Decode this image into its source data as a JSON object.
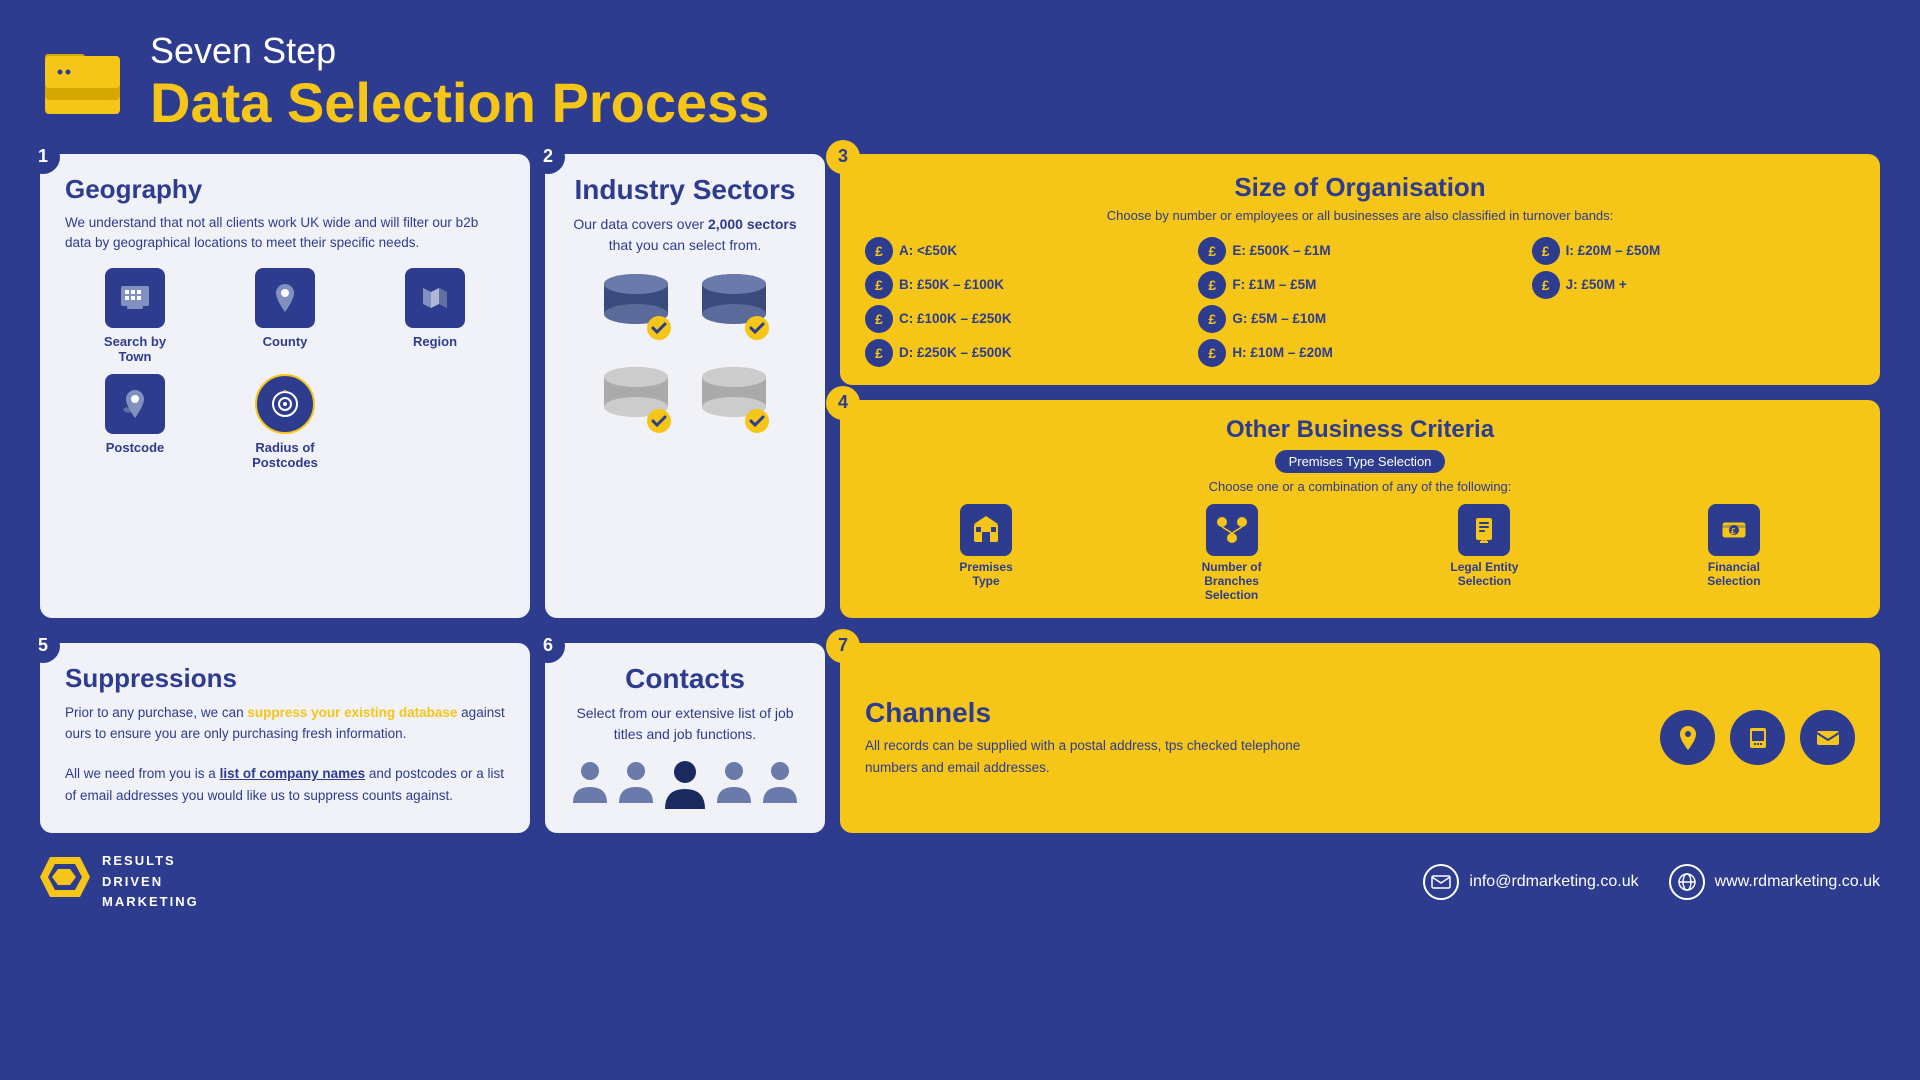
{
  "header": {
    "subtitle": "Seven Step",
    "title": "Data Selection Process"
  },
  "step1": {
    "num": "1",
    "title": "Geography",
    "body": "We understand that not all clients work UK wide and will filter our b2b data by geographical locations to meet their specific needs.",
    "icons": [
      {
        "label": "Search by Town",
        "icon": "🏢"
      },
      {
        "label": "County",
        "icon": "📍"
      },
      {
        "label": "Region",
        "icon": "🗺"
      },
      {
        "label": "Postcode",
        "icon": "📌"
      },
      {
        "label": "Radius of Postcodes",
        "icon": "⊙"
      }
    ]
  },
  "step2": {
    "num": "2",
    "title": "Industry Sectors",
    "body": "Our data covers over 2,000 sectors that you can select from."
  },
  "step3": {
    "num": "3",
    "title": "Size of Organisation",
    "subtitle": "Choose by number or employees or all businesses are also classified in turnover bands:",
    "items": [
      {
        "label": "A: <£50K"
      },
      {
        "label": "E: £500K – £1M"
      },
      {
        "label": "I: £20M – £50M"
      },
      {
        "label": "B: £50K – £100K"
      },
      {
        "label": "F: £1M – £5M"
      },
      {
        "label": "J: £50M +"
      },
      {
        "label": "C: £100K – £250K"
      },
      {
        "label": "G: £5M – £10M"
      },
      {
        "label": ""
      },
      {
        "label": "D: £250K – £500K"
      },
      {
        "label": "H: £10M – £20M"
      },
      {
        "label": ""
      }
    ]
  },
  "step4": {
    "num": "4",
    "title": "Other Business Criteria",
    "badge": "Premises Type Selection",
    "subtitle": "Choose one or a combination of any of the following:",
    "icons": [
      {
        "label": "Premises Type",
        "icon": "🏢"
      },
      {
        "label": "Number of Branches Selection",
        "icon": "📍"
      },
      {
        "label": "Legal Entity Selection",
        "icon": "⚖"
      },
      {
        "label": "Financial Selection",
        "icon": "💷"
      }
    ]
  },
  "step5": {
    "num": "5",
    "title": "Suppressions",
    "body1": "Prior to any purchase, we can",
    "highlight1": "suppress your existing database",
    "body1b": "against ours to ensure you are only purchasing fresh information.",
    "body2_pre": "All we need from you is a",
    "link_text": "list of company names",
    "body2_post": "and postcodes or a list of email addresses you would like us to suppress counts against."
  },
  "step6": {
    "num": "6",
    "title": "Contacts",
    "body": "Select from our extensive list of job titles and job functions."
  },
  "step7": {
    "num": "7",
    "title": "Channels",
    "body": "All records can be supplied with a postal address, tps checked telephone numbers and email addresses."
  },
  "footer": {
    "logo_lines": [
      "RESULTS",
      "DRIVEN",
      "MARKETING"
    ],
    "email": "info@rdmarketing.co.uk",
    "website": "www.rdmarketing.co.uk"
  }
}
